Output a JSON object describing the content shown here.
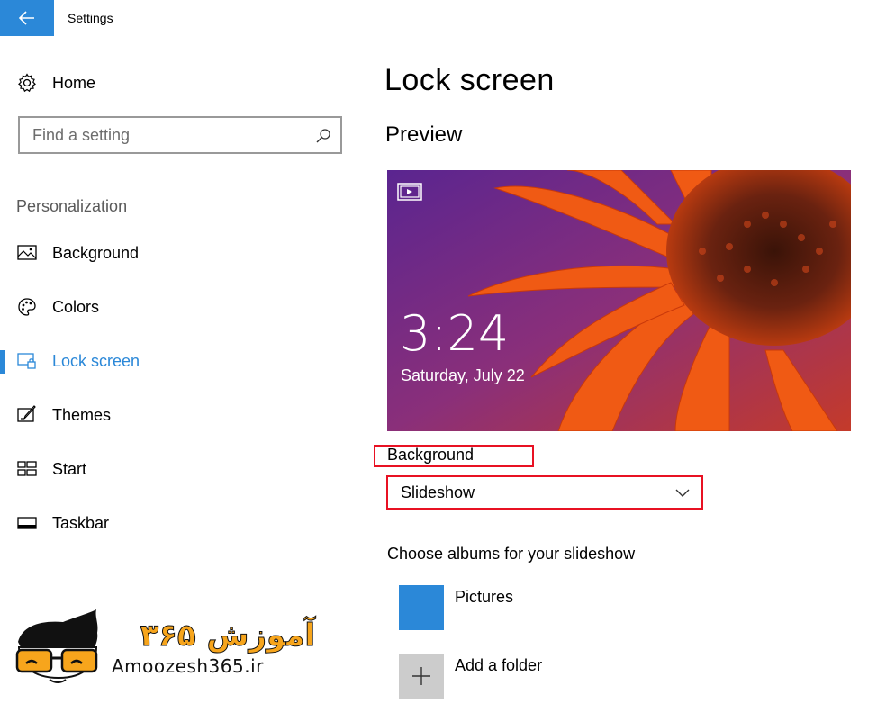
{
  "window": {
    "title": "Settings",
    "back_icon": "arrow-left-icon",
    "accent_color": "#2b88d8"
  },
  "sidebar": {
    "home_label": "Home",
    "search_placeholder": "Find a setting",
    "section_label": "Personalization",
    "items": [
      {
        "label": "Background",
        "icon": "picture-icon",
        "active": false
      },
      {
        "label": "Colors",
        "icon": "palette-icon",
        "active": false
      },
      {
        "label": "Lock screen",
        "icon": "lock-screen-icon",
        "active": true
      },
      {
        "label": "Themes",
        "icon": "themes-brush-icon",
        "active": false
      },
      {
        "label": "Start",
        "icon": "start-tiles-icon",
        "active": false
      },
      {
        "label": "Taskbar",
        "icon": "taskbar-icon",
        "active": false
      }
    ]
  },
  "main": {
    "page_title": "Lock screen",
    "preview_title": "Preview",
    "preview": {
      "time": "3:24",
      "date": "Saturday, July 22"
    },
    "background_label": "Background",
    "background_value": "Slideshow",
    "albums_label": "Choose albums for your slideshow",
    "albums": [
      {
        "label": "Pictures"
      },
      {
        "label": "Add a folder"
      }
    ],
    "highlight_color": "#e81123"
  },
  "watermark": {
    "brand_text": "آموزش ۳۶۵",
    "url": "Amoozesh365.ir"
  }
}
